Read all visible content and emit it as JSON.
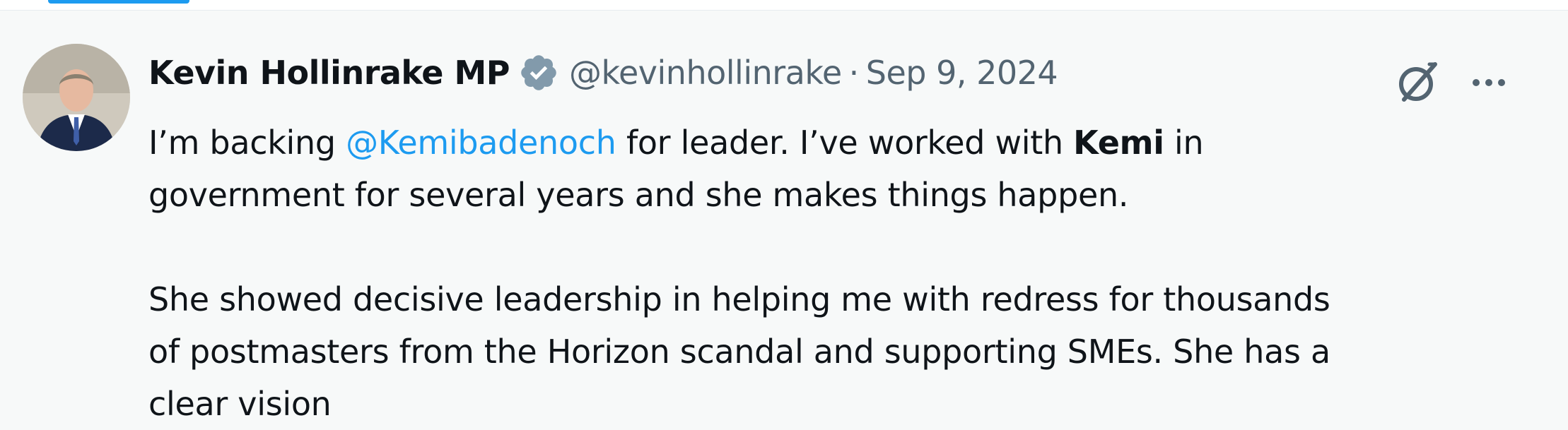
{
  "post": {
    "author": {
      "display_name": "Kevin Hollinrake MP",
      "handle": "@kevinhollinrake",
      "verified": true,
      "avatar_icon": "profile-photo"
    },
    "separator": "·",
    "date": "Sep 9, 2024",
    "actions": {
      "grok_icon": "grok-icon",
      "more_icon": "more-horizontal-icon"
    },
    "body": {
      "line1_a": "I’m backing",
      "mention": "@Kemibadenoch",
      "line1_b": "for leader. I’ve worked with",
      "bold_name": "Kemi",
      "line1_c": "in",
      "line2": "government for several years and she makes things happen.",
      "para2_line1": "She showed decisive leadership in helping me with redress for thousands",
      "para2_line2": "of postmasters from the Horizon scandal and supporting SMEs. She has a",
      "para2_line3": "clear vision"
    }
  },
  "colors": {
    "accent": "#1d9bf0",
    "secondary_text": "#536471",
    "background": "#f7f9f9"
  }
}
